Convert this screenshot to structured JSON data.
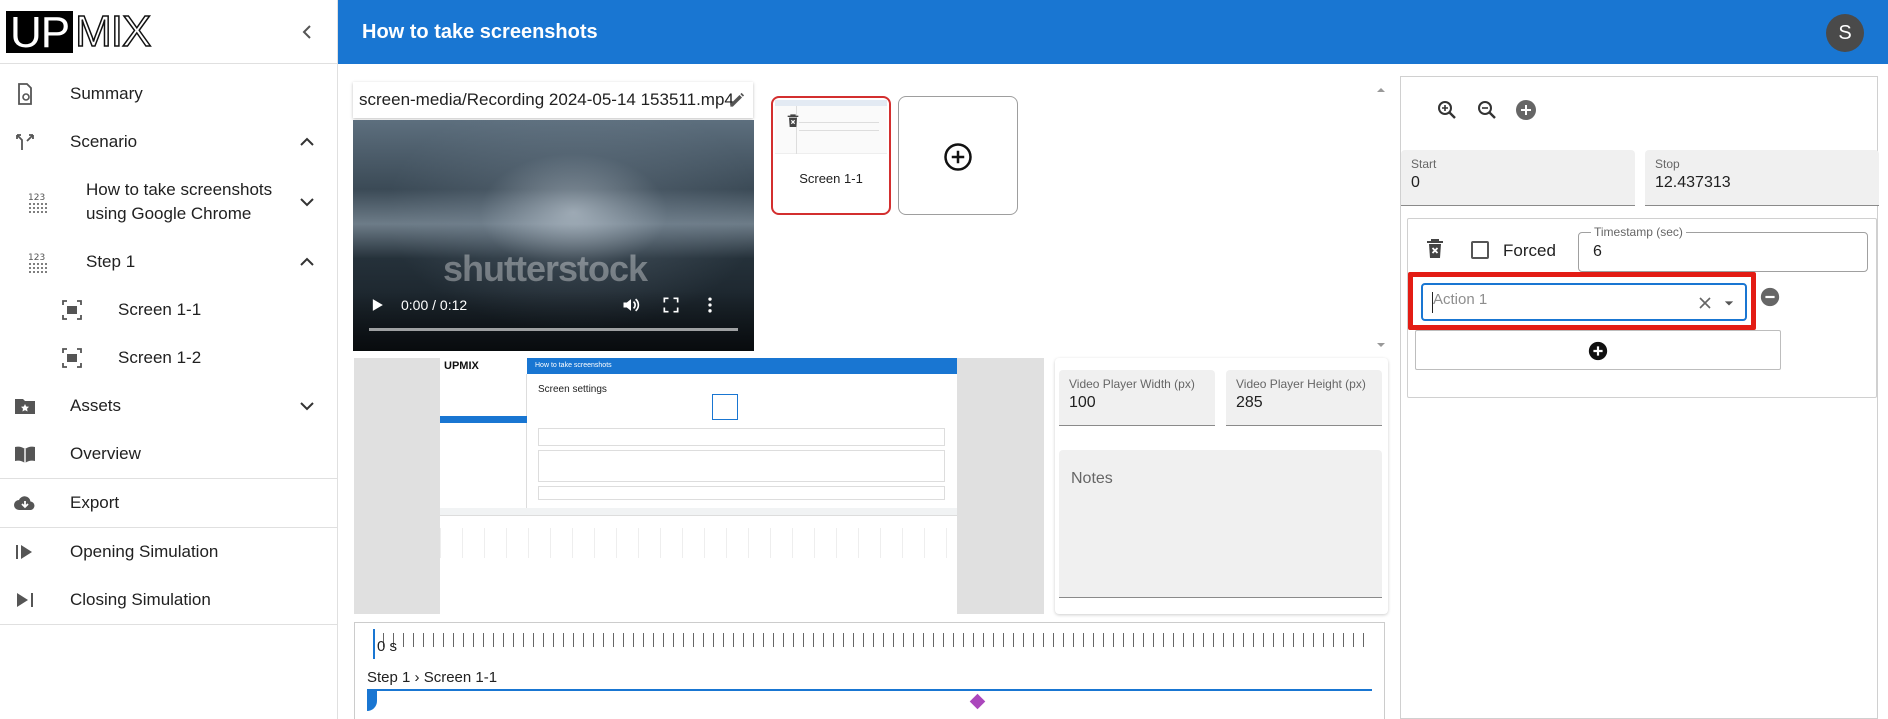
{
  "app": {
    "logo_left": "UP",
    "logo_right": "MIX",
    "title": "How to take screenshots",
    "user_initial": "S"
  },
  "sidebar": {
    "items": [
      {
        "label": "Summary",
        "icon": "settings-doc-icon"
      },
      {
        "label": "Scenario",
        "icon": "scenario-branch-icon"
      },
      {
        "label": "How to take screenshots using Google Chrome",
        "icon": "numbered-list-icon"
      },
      {
        "label": "Step 1",
        "icon": "numbered-list-icon"
      },
      {
        "label": "Screen 1-1",
        "icon": "screenshot-icon"
      },
      {
        "label": "Screen 1-2",
        "icon": "screenshot-icon"
      },
      {
        "label": "Assets",
        "icon": "folder-star-icon"
      },
      {
        "label": "Overview",
        "icon": "book-icon"
      },
      {
        "label": "Export",
        "icon": "cloud-download-icon"
      },
      {
        "label": "Opening Simulation",
        "icon": "play-start-icon"
      },
      {
        "label": "Closing Simulation",
        "icon": "skip-end-icon"
      }
    ]
  },
  "media": {
    "file_name": "screen-media/Recording 2024-05-14 153511.mp4",
    "video_time": "0:00 / 0:12",
    "watermark": "shutterstock",
    "screens": [
      {
        "label": "Screen 1-1"
      }
    ]
  },
  "preview": {
    "mini_logo": "UPMIX",
    "mini_title": "How to take screenshots",
    "mini_heading": "Screen settings"
  },
  "settings": {
    "width_label": "Video Player Width (px)",
    "width_value": "100",
    "height_label": "Video Player Height (px)",
    "height_value": "285",
    "notes_placeholder": "Notes"
  },
  "timeline": {
    "start_label": "0 s",
    "track_label": "Step 1 › Screen 1-1"
  },
  "right": {
    "start_label": "Start",
    "start_value": "0",
    "stop_label": "Stop",
    "stop_value": "12.437313",
    "forced_label": "Forced",
    "timestamp_label": "Timestamp (sec)",
    "timestamp_value": "6",
    "action_placeholder": "Action 1"
  },
  "colors": {
    "primary": "#1976d2",
    "highlight": "#e31c14",
    "selected_thumb_border": "#d32f2f",
    "marker": "#ab47bc"
  }
}
